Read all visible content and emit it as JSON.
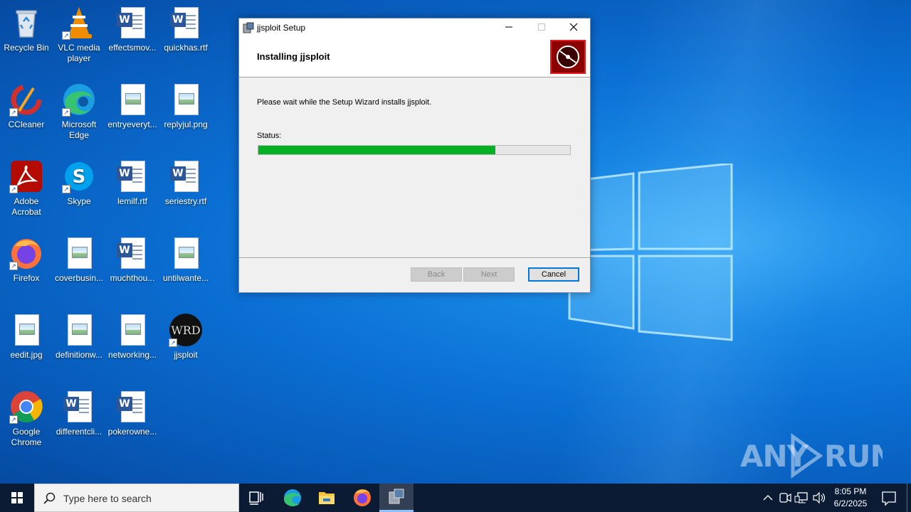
{
  "desktop": {
    "icons": [
      {
        "label": "Recycle Bin"
      },
      {
        "label": "VLC media player"
      },
      {
        "label": "effectsmov..."
      },
      {
        "label": "quickhas.rtf"
      },
      {
        "label": "CCleaner"
      },
      {
        "label": "Microsoft Edge"
      },
      {
        "label": "entryeveryt..."
      },
      {
        "label": "replyjul.png"
      },
      {
        "label": "Adobe Acrobat"
      },
      {
        "label": "Skype"
      },
      {
        "label": "lemilf.rtf"
      },
      {
        "label": "seriestry.rtf"
      },
      {
        "label": "Firefox"
      },
      {
        "label": "coverbusin..."
      },
      {
        "label": "muchthou..."
      },
      {
        "label": "untilwante..."
      },
      {
        "label": "eedit.jpg"
      },
      {
        "label": "definitionw..."
      },
      {
        "label": "networking..."
      },
      {
        "label": "jjsploit"
      },
      {
        "label": "Google Chrome"
      },
      {
        "label": "differentcli..."
      },
      {
        "label": "pokerowne..."
      }
    ],
    "watermark": "ANY RUN"
  },
  "dialog": {
    "title": "jjsploit Setup",
    "header_title": "Installing jjsploit",
    "message": "Please wait while the Setup Wizard installs jjsploit.",
    "status_label": "Status:",
    "progress": 0.76,
    "buttons": {
      "back": "Back",
      "next": "Next",
      "cancel": "Cancel"
    }
  },
  "taskbar": {
    "search_placeholder": "Type here to search",
    "time": "8:05 PM",
    "date": "6/2/2025"
  },
  "colors": {
    "progress_fill": "#06b025",
    "taskbar": "#0b1b34",
    "desktop": "#0b6fd3"
  }
}
